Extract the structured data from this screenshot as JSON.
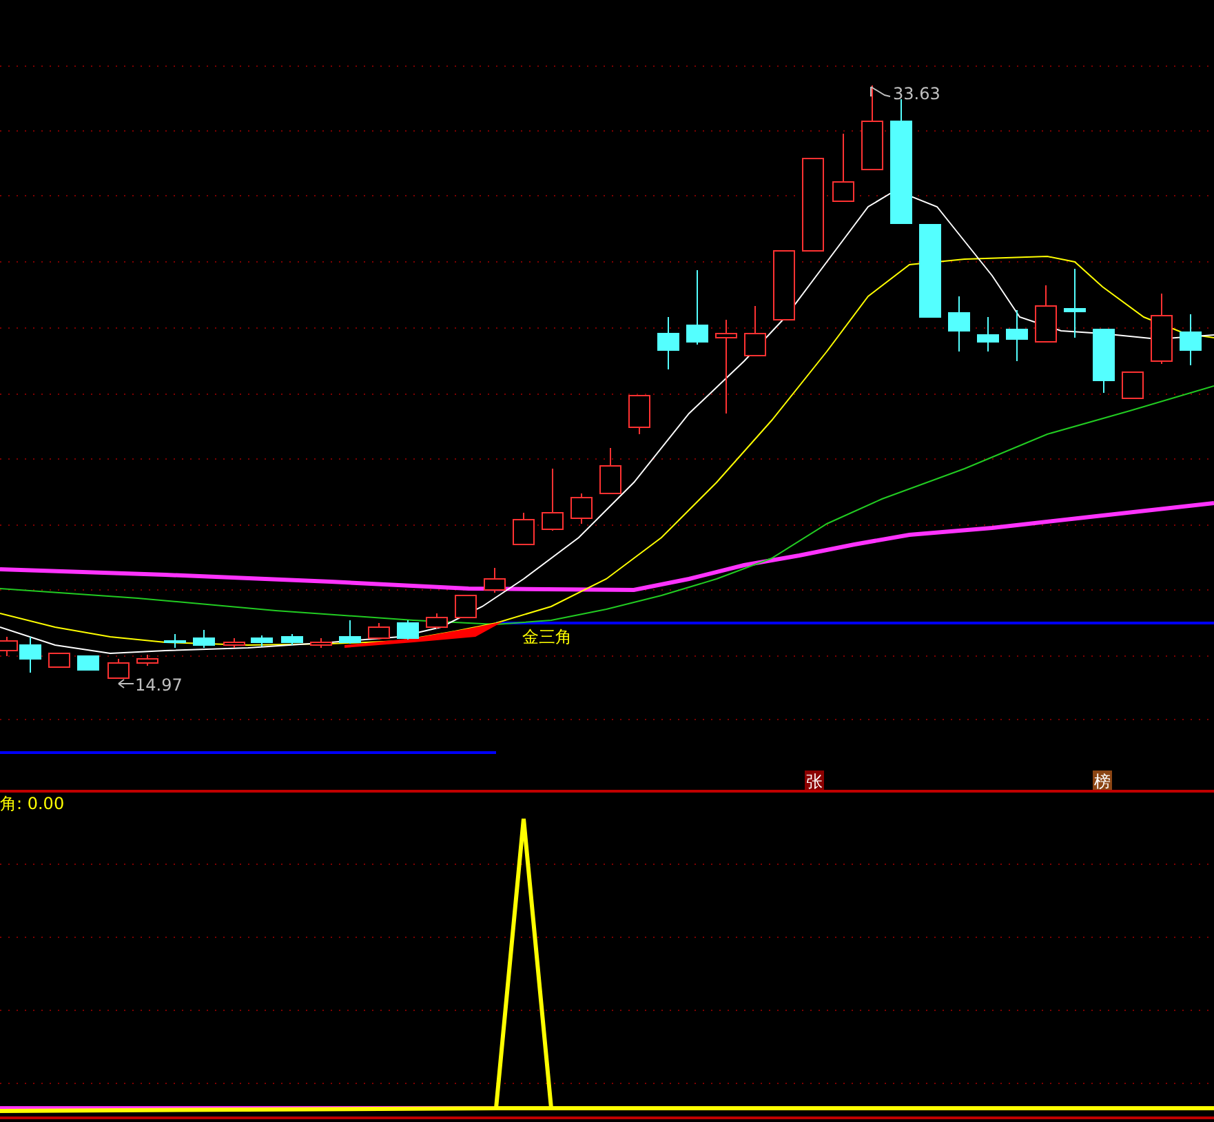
{
  "price_panel": {
    "high_label": "33.63",
    "low_label": "14.97",
    "signal_label": "金三角",
    "markers": [
      {
        "text": "张",
        "color": "#8b0000"
      },
      {
        "text": "榜",
        "color": "#8b4513"
      }
    ]
  },
  "indicator_panel": {
    "label": "角: 0.00"
  }
}
